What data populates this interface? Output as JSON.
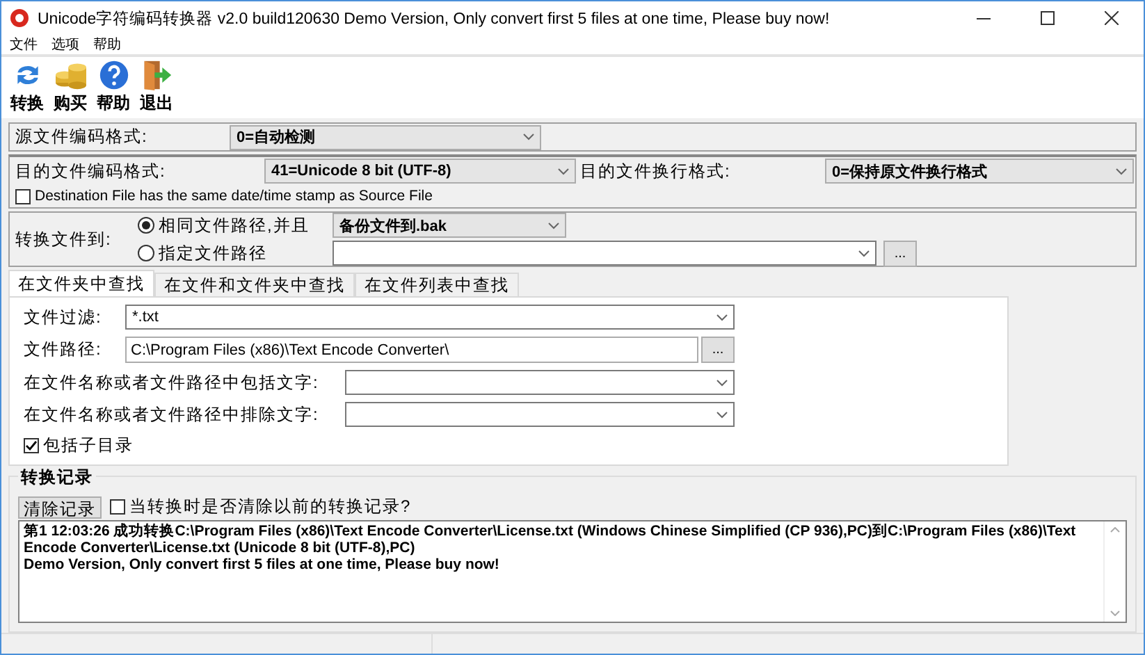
{
  "window": {
    "title": "Unicode字符编码转换器 v2.0 build120630 Demo Version, Only convert first 5 files at one time, Please buy now!"
  },
  "menu": [
    "文件",
    "选项",
    "帮助"
  ],
  "toolbar": [
    {
      "label": "转换",
      "kind": "convert"
    },
    {
      "label": "购买",
      "kind": "buy"
    },
    {
      "label": "帮助",
      "kind": "help"
    },
    {
      "label": "退出",
      "kind": "exit"
    }
  ],
  "source_encoding": {
    "label": "源文件编码格式:",
    "value": "0=自动检测"
  },
  "target_encoding": {
    "label": "目的文件编码格式:",
    "value": "41=Unicode 8 bit (UTF-8)"
  },
  "line_ending": {
    "label": "目的文件换行格式:",
    "value": "0=保持原文件换行格式"
  },
  "same_timestamp": {
    "label": "Destination File has the same date/time stamp as Source File",
    "checked": false
  },
  "convert_to": {
    "label": "转换文件到:",
    "options": [
      {
        "label": "相同文件路径,并且",
        "selected": true
      },
      {
        "label": "指定文件路径",
        "selected": false
      }
    ],
    "backup_value": "备份文件到.bak",
    "browse_button": "..."
  },
  "tabs": [
    {
      "label": "在文件夹中查找",
      "selected": true
    },
    {
      "label": "在文件和文件夹中查找",
      "selected": false
    },
    {
      "label": "在文件列表中查找",
      "selected": false
    }
  ],
  "filter": {
    "label": "文件过滤:",
    "value": "*.txt"
  },
  "path": {
    "label": "文件路径:",
    "value": "C:\\Program Files (x86)\\Text Encode Converter\\",
    "button": "..."
  },
  "include": {
    "label": "在文件名称或者文件路径中包括文字:"
  },
  "exclude": {
    "label": "在文件名称或者文件路径中排除文字:"
  },
  "subdirs": {
    "label": "包括子目录",
    "checked": true
  },
  "log": {
    "title": "转换记录",
    "clear_button": "清除记录",
    "clear_on_convert": {
      "label": "当转换时是否清除以前的转换记录?",
      "checked": false
    },
    "entries": [
      "第1 12:03:26 成功转换C:\\Program Files (x86)\\Text Encode Converter\\License.txt (Windows Chinese Simplified (CP 936),PC)到C:\\Program Files (x86)\\Text Encode Converter\\License.txt (Unicode 8 bit (UTF-8),PC)",
      "Demo Version, Only convert first 5 files at one time, Please buy now!"
    ]
  }
}
